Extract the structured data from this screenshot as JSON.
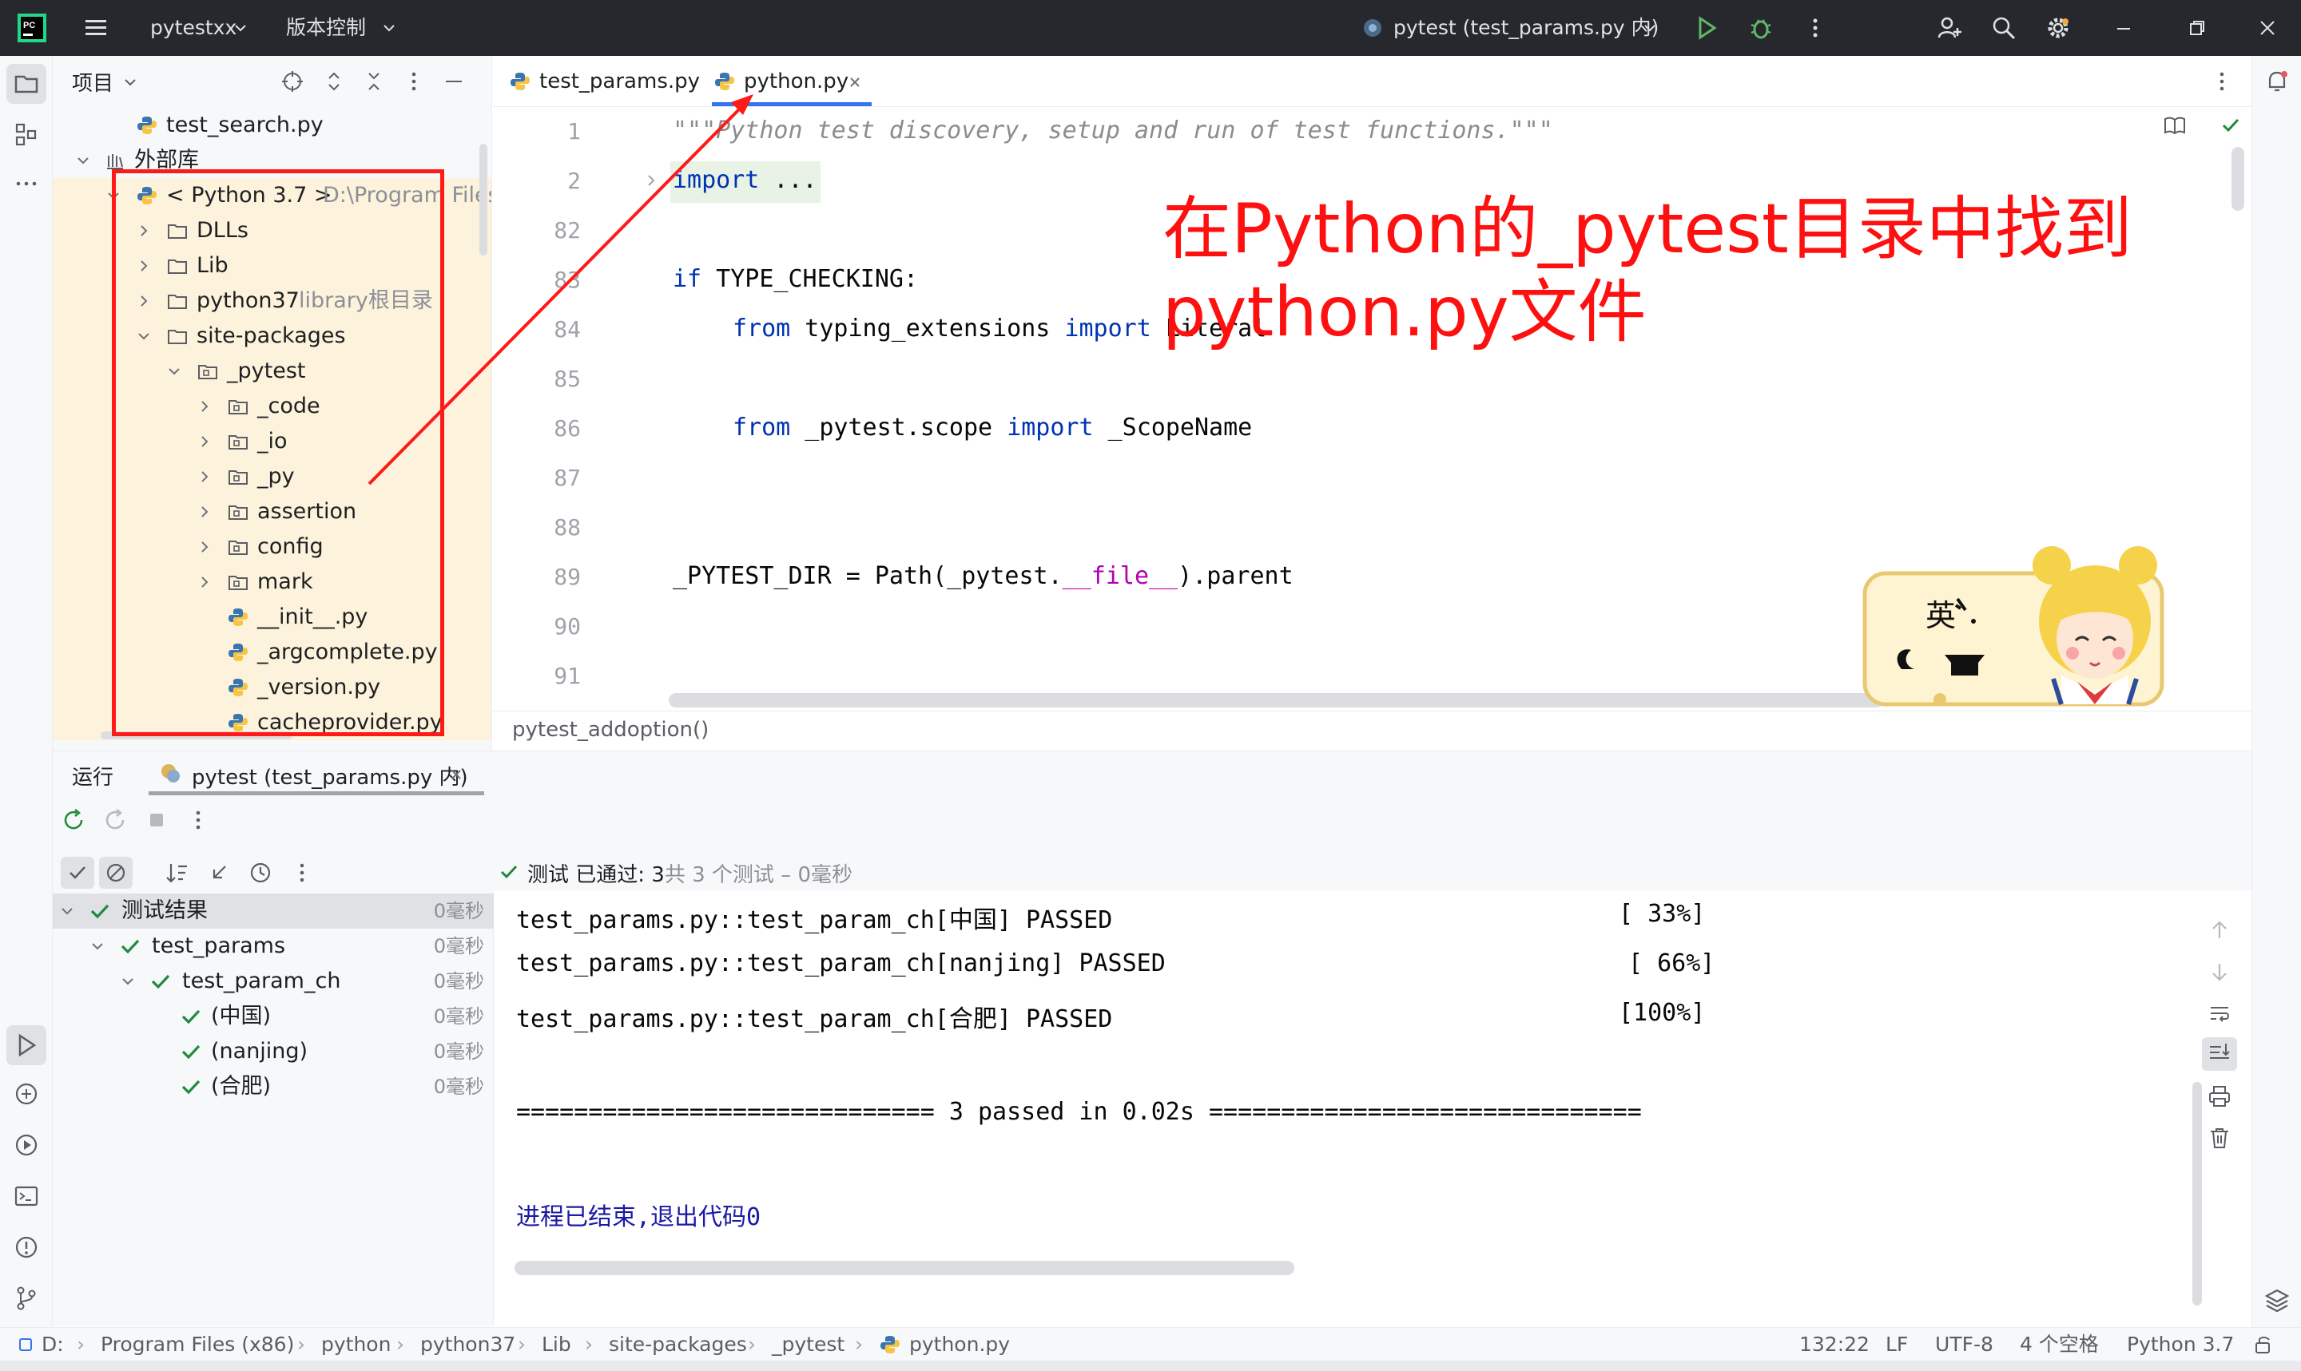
{
  "titlebar": {
    "project_name": "pytestxx",
    "vcs_label": "版本控制",
    "run_config": "pytest (test_params.py 内)"
  },
  "project_panel": {
    "title": "项目",
    "rows": [
      {
        "label": "test_search.py",
        "hint": ""
      },
      {
        "label": "外部库",
        "hint": ""
      },
      {
        "label": "< Python 3.7 >",
        "hint": "D:\\Program Files"
      },
      {
        "label": "DLLs",
        "hint": ""
      },
      {
        "label": "Lib",
        "hint": ""
      },
      {
        "label": "python37",
        "hint": "library根目录"
      },
      {
        "label": "site-packages",
        "hint": ""
      },
      {
        "label": "_pytest",
        "hint": ""
      },
      {
        "label": "_code",
        "hint": ""
      },
      {
        "label": "_io",
        "hint": ""
      },
      {
        "label": "_py",
        "hint": ""
      },
      {
        "label": "assertion",
        "hint": ""
      },
      {
        "label": "config",
        "hint": ""
      },
      {
        "label": "mark",
        "hint": ""
      },
      {
        "label": "__init__.py",
        "hint": ""
      },
      {
        "label": "_argcomplete.py",
        "hint": ""
      },
      {
        "label": "_version.py",
        "hint": ""
      },
      {
        "label": "cacheprovider.py",
        "hint": ""
      }
    ]
  },
  "editor": {
    "tabs": [
      {
        "label": "test_params.py"
      },
      {
        "label": "python.py"
      }
    ],
    "line_numbers": [
      "1",
      "2",
      "82",
      "83",
      "84",
      "85",
      "86",
      "87",
      "88",
      "89",
      "90",
      "91"
    ],
    "code": {
      "l1": "\"\"\"Python test discovery, setup and run of test functions.\"\"\"",
      "l2_kw": "import",
      "l2_rest": " ...",
      "l83_kw": "if",
      "l83_rest": " TYPE_CHECKING:",
      "l84_kw1": "from",
      "l84_mod": " typing_extensions ",
      "l84_kw2": "import",
      "l84_name": " Literal",
      "l86_kw1": "from",
      "l86_mod": " _pytest.scope ",
      "l86_kw2": "import",
      "l86_name": " _ScopeName",
      "l89_a": "_PYTEST_DIR = Path(_pytest.",
      "l89_dunder": "__file__",
      "l89_b": ").parent"
    },
    "breadcrumb": "pytest_addoption()"
  },
  "annotation": {
    "line1": "在Python的_pytest目录中找到",
    "line2": "python.py文件"
  },
  "sticker": {
    "char": "英"
  },
  "run_panel": {
    "title": "运行",
    "tab_label": "pytest (test_params.py 内)",
    "summary_prefix": "测试 已通过: 3",
    "summary_suffix": "共 3 个测试 – 0毫秒",
    "tree": [
      {
        "label": "测试结果",
        "time": "0毫秒"
      },
      {
        "label": "test_params",
        "time": "0毫秒"
      },
      {
        "label": "test_param_ch",
        "time": "0毫秒"
      },
      {
        "label": "(中国)",
        "time": "0毫秒"
      },
      {
        "label": "(nanjing)",
        "time": "0毫秒"
      },
      {
        "label": "(合肥)",
        "time": "0毫秒"
      }
    ],
    "console": {
      "line1": "test_params.py::test_param_ch[中国] PASSED",
      "line1_pct": "[ 33%]",
      "line2": "test_params.py::test_param_ch[nanjing] PASSED",
      "line2_pct": "[ 66%]",
      "line3": "test_params.py::test_param_ch[合肥] PASSED",
      "line3_pct": "[100%]",
      "summary": "============================= 3 passed in 0.02s ==============================",
      "exit": "进程已结束,退出代码0"
    }
  },
  "statusbar": {
    "path": [
      "D:",
      "Program Files (x86)",
      "python",
      "python37",
      "Lib",
      "site-packages",
      "_pytest",
      "python.py"
    ],
    "position": "132:22",
    "line_ending": "LF",
    "encoding": "UTF-8",
    "indent": "4 个空格",
    "interpreter": "Python 3.7"
  },
  "colors": {
    "accent": "#3574f0",
    "success": "#208a3c",
    "annotation": "#ff1a1a",
    "titlebar_bg": "#27282e"
  }
}
